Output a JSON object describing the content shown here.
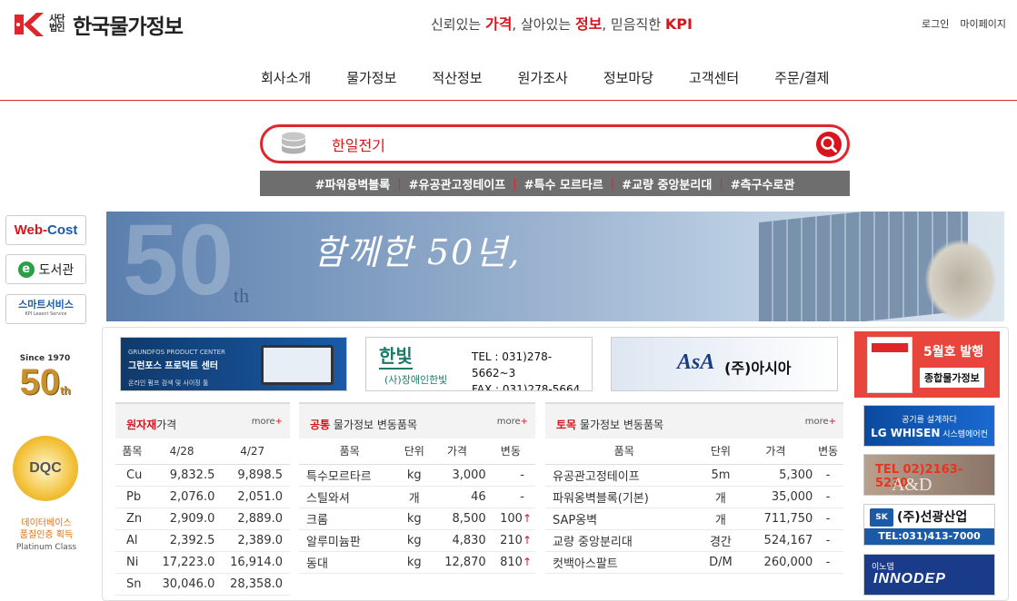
{
  "header": {
    "logo_sub": "사단법인",
    "logo_name": "한국물가정보",
    "tagline": {
      "p1": "신뢰있는 ",
      "w1": "가격",
      "p2": ", 살아있는 ",
      "w2": "정보",
      "p3": ", 믿음직한 ",
      "w3": "KPI"
    },
    "login": "로그인",
    "mypage": "마이페이지"
  },
  "nav": [
    "회사소개",
    "물가정보",
    "적산정보",
    "원가조사",
    "정보마당",
    "고객센터",
    "주문/결제"
  ],
  "search": {
    "value": "한일전기"
  },
  "tags": [
    "#파워융벽블록",
    "#유공관고정테이프",
    "#특수 모르타르",
    "#교량 중앙분리대",
    "#측구수로관"
  ],
  "quick": {
    "webcost_a": "Web-",
    "webcost_b": "Cost",
    "library": "도서관",
    "library_e": "e",
    "smart": "스마트서비스",
    "smart_sub": "KPI Leasnt Service"
  },
  "badge": {
    "since": "Since 1970",
    "num": "50",
    "th": "th"
  },
  "dqc": {
    "label": "DQC",
    "line1": "데이터베이스",
    "line2": "품질인증 획득",
    "line3": "Platinum Class"
  },
  "hero": {
    "message": "함께한 50년,",
    "big": "50",
    "th": "th"
  },
  "ads": {
    "grundfos": {
      "t1": "GRUNDFOS PRODUCT CENTER",
      "t2": "그런포스 프로덕트 센터",
      "t3": "온라인 펌프 검색 및 사이징 툴"
    },
    "hanbit": {
      "logo": "한빛",
      "org": "(사)장애인한빛",
      "tel": "TEL : 031)278-5662~3",
      "fax": "FAX : 031)278-5664"
    },
    "asia": {
      "logo": "AsA",
      "name": "(주)아시아"
    },
    "kpi_book": {
      "m1": "5월호 발행",
      "m2": "종합물가정보"
    }
  },
  "tables": {
    "raw": {
      "title_red": "원자재",
      "title_rest": "가격",
      "more": "more",
      "headers": [
        "품목",
        "4/28",
        "4/27"
      ],
      "rows": [
        [
          "Cu",
          "9,832.5",
          "9,898.5"
        ],
        [
          "Pb",
          "2,076.0",
          "2,051.0"
        ],
        [
          "Zn",
          "2,909.0",
          "2,889.0"
        ],
        [
          "Al",
          "2,392.5",
          "2,389.0"
        ],
        [
          "Ni",
          "17,223.0",
          "16,914.0"
        ],
        [
          "Sn",
          "30,046.0",
          "28,358.0"
        ]
      ]
    },
    "common": {
      "title_red": "공통",
      "title_rest": " 물가정보 변동품목",
      "more": "more",
      "headers": [
        "품목",
        "단위",
        "가격",
        "변동"
      ],
      "rows": [
        [
          "특수모르타르",
          "kg",
          "3,000",
          "-",
          ""
        ],
        [
          "스틸와셔",
          "개",
          "46",
          "-",
          ""
        ],
        [
          "크롬",
          "kg",
          "8,500",
          "100",
          "↑"
        ],
        [
          "알루미늄판",
          "kg",
          "4,830",
          "210",
          "↑"
        ],
        [
          "동대",
          "kg",
          "12,870",
          "810",
          "↑"
        ]
      ]
    },
    "civil": {
      "title_red": "토목",
      "title_rest": " 물가정보 변동품목",
      "more": "more",
      "headers": [
        "품목",
        "단위",
        "가격",
        "변동"
      ],
      "rows": [
        [
          "유공관고정테이프",
          "5m",
          "5,300",
          "-"
        ],
        [
          "파워옹벽블록(기본)",
          "개",
          "35,000",
          "-"
        ],
        [
          "SAP옹벽",
          "개",
          "711,750",
          "-"
        ],
        [
          "교량 중앙분리대",
          "경간",
          "524,167",
          "-"
        ],
        [
          "컷백아스팔트",
          "D/M",
          "260,000",
          "-"
        ]
      ]
    }
  },
  "right_ads": {
    "lg": {
      "a": "공기를 설계하다",
      "b": "LG WHISEN",
      "c": " 시스템에어컨"
    },
    "ad": {
      "tel": "TEL 02)2163-5230",
      "logo": "A&D"
    },
    "sk": {
      "logo": "SK",
      "name": "(주)선광산업",
      "tel": "TEL:031)413-7000"
    },
    "innodep": {
      "n": "이노뎁",
      "logo": "INNODEP"
    }
  },
  "colors": {
    "brand_red": "#d8141c",
    "tag_bar": "#6e6e6e"
  }
}
